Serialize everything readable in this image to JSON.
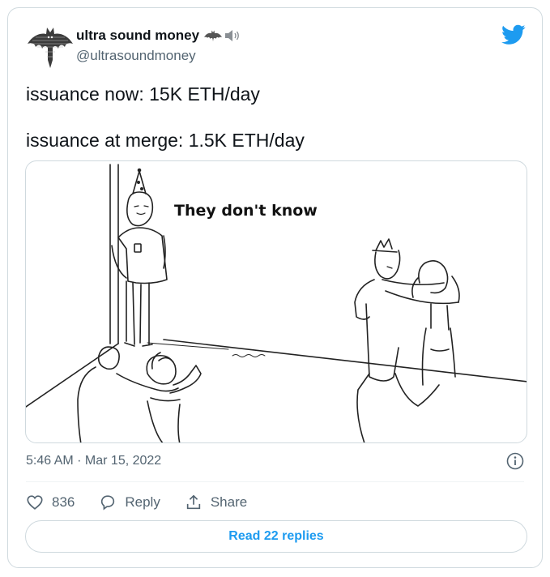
{
  "tweet": {
    "display_name": "ultra sound money",
    "handle": "@ultrasoundmoney",
    "text_lines": [
      "issuance now: 15K ETH/day",
      "issuance at merge: 1.5K ETH/day"
    ],
    "timestamp": "5:46 AM · Mar 15, 2022",
    "name_emojis": [
      "bat-icon",
      "speaker-icon"
    ],
    "accent_color": "#1d9bf0"
  },
  "media": {
    "caption": "They don't know"
  },
  "actions": {
    "like_count": "836",
    "reply_label": "Reply",
    "share_label": "Share"
  },
  "footer": {
    "read_replies_label": "Read 22 replies"
  }
}
